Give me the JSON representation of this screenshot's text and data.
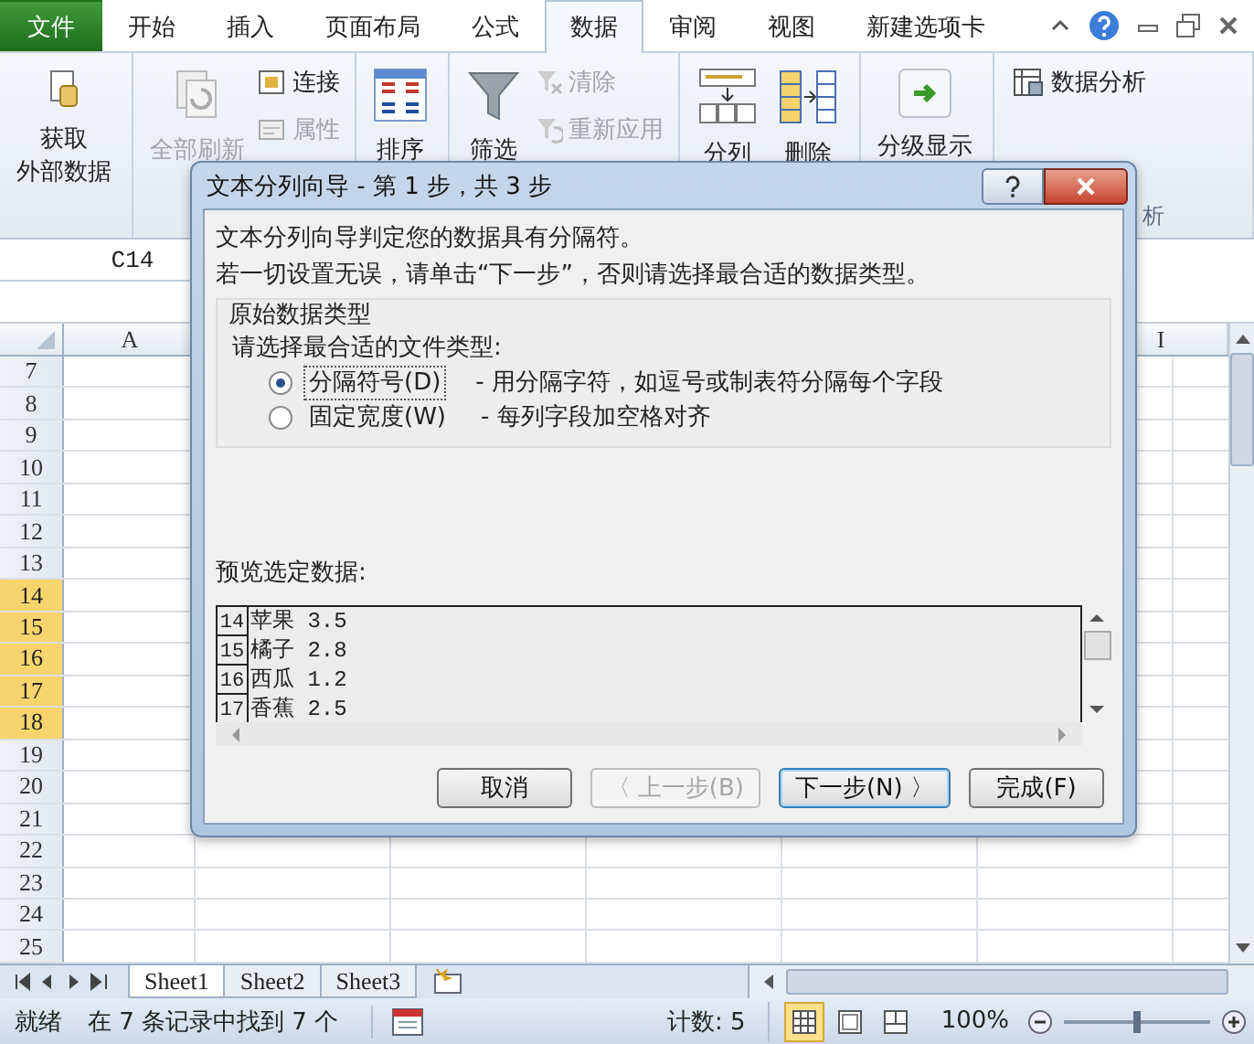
{
  "ribbon_tabs": [
    {
      "label": "文件",
      "kind": "file",
      "selected": false
    },
    {
      "label": "开始",
      "kind": "tab",
      "selected": false
    },
    {
      "label": "插入",
      "kind": "tab",
      "selected": false
    },
    {
      "label": "页面布局",
      "kind": "tab",
      "selected": false
    },
    {
      "label": "公式",
      "kind": "tab",
      "selected": false
    },
    {
      "label": "数据",
      "kind": "tab",
      "selected": true
    },
    {
      "label": "审阅",
      "kind": "tab",
      "selected": false
    },
    {
      "label": "视图",
      "kind": "tab",
      "selected": false
    },
    {
      "label": "新建选项卡",
      "kind": "tab",
      "selected": false
    }
  ],
  "ribbon_groups": [
    {
      "buttons": [
        {
          "label_lines": [
            "获取",
            "外部数据"
          ],
          "kind": "large",
          "disabled": false
        }
      ]
    },
    {
      "buttons": [
        {
          "label_lines": [
            "全部刷新"
          ],
          "kind": "large",
          "disabled": true
        },
        {
          "label_lines": [
            "连接"
          ],
          "kind": "small",
          "disabled": false
        },
        {
          "label_lines": [
            "属性"
          ],
          "kind": "small",
          "disabled": true
        }
      ]
    },
    {
      "buttons": [
        {
          "label_lines": [
            "排序"
          ],
          "kind": "large",
          "disabled": false
        }
      ]
    },
    {
      "buttons": [
        {
          "label_lines": [
            "筛选"
          ],
          "kind": "large",
          "disabled": false
        },
        {
          "label_lines": [
            "清除"
          ],
          "kind": "small",
          "disabled": true
        },
        {
          "label_lines": [
            "重新应用"
          ],
          "kind": "small",
          "disabled": true
        }
      ]
    },
    {
      "buttons": [
        {
          "label_lines": [
            "分列"
          ],
          "kind": "large",
          "disabled": false
        },
        {
          "label_lines": [
            "删除"
          ],
          "kind": "large",
          "disabled": false
        }
      ]
    },
    {
      "buttons": [
        {
          "label_lines": [
            "分级显示"
          ],
          "kind": "large",
          "disabled": false
        }
      ]
    },
    {
      "buttons": [
        {
          "label_lines": [
            "数据分析"
          ],
          "kind": "small",
          "disabled": false
        }
      ],
      "label": "析"
    }
  ],
  "name_box": "C14",
  "column_headers": [
    "A",
    "I"
  ],
  "rows": [
    {
      "label": "7",
      "selected": false
    },
    {
      "label": "8",
      "selected": false
    },
    {
      "label": "9",
      "selected": false
    },
    {
      "label": "10",
      "selected": false
    },
    {
      "label": "11",
      "selected": false
    },
    {
      "label": "12",
      "selected": false
    },
    {
      "label": "13",
      "selected": false
    },
    {
      "label": "14",
      "selected": true
    },
    {
      "label": "15",
      "selected": true
    },
    {
      "label": "16",
      "selected": true
    },
    {
      "label": "17",
      "selected": true
    },
    {
      "label": "18",
      "selected": true
    },
    {
      "label": "19",
      "selected": false
    },
    {
      "label": "20",
      "selected": false
    },
    {
      "label": "21",
      "selected": false
    },
    {
      "label": "22",
      "selected": false
    },
    {
      "label": "23",
      "selected": false
    },
    {
      "label": "24",
      "selected": false
    },
    {
      "label": "25",
      "selected": false
    }
  ],
  "dialog": {
    "title": "文本分列向导 - 第 1 步，共 3 步",
    "lines": [
      "文本分列向导判定您的数据具有分隔符。",
      "若一切设置无误，请单击“下一步”，否则请选择最合适的数据类型。"
    ],
    "group_title": "原始数据类型",
    "prompt": "请选择最合适的文件类型:",
    "options": [
      {
        "label": "分隔符号(D)",
        "description": "- 用分隔字符，如逗号或制表符分隔每个字段",
        "selected": true
      },
      {
        "label": "固定宽度(W)",
        "description": "- 每列字段加空格对齐",
        "selected": false
      }
    ],
    "preview_label": "预览选定数据:",
    "preview_rows": [
      {
        "number": "14",
        "text": "苹果 3.5"
      },
      {
        "number": "15",
        "text": "橘子 2.8"
      },
      {
        "number": "16",
        "text": "西瓜 1.2"
      },
      {
        "number": "17",
        "text": "香蕉 2.5"
      }
    ],
    "buttons": [
      {
        "label": "取消",
        "disabled": false,
        "default": false
      },
      {
        "label": "〈 上一步(B)",
        "disabled": true,
        "default": false
      },
      {
        "label": "下一步(N) 〉",
        "disabled": false,
        "default": true
      },
      {
        "label": "完成(F)",
        "disabled": false,
        "default": false
      }
    ]
  },
  "sheet_tabs": [
    {
      "label": "Sheet1",
      "selected": true
    },
    {
      "label": "Sheet2",
      "selected": false
    },
    {
      "label": "Sheet3",
      "selected": false
    }
  ],
  "status_bar": {
    "mode": "就绪",
    "find_result": "在 7 条记录中找到 7 个",
    "count": "计数: 5",
    "zoom": "100%",
    "zoom_slider": {
      "level": 0.5
    },
    "views": [
      {
        "kind": "normal",
        "selected": true
      },
      {
        "kind": "layout",
        "selected": false
      },
      {
        "kind": "pagebreak",
        "selected": false
      }
    ]
  }
}
